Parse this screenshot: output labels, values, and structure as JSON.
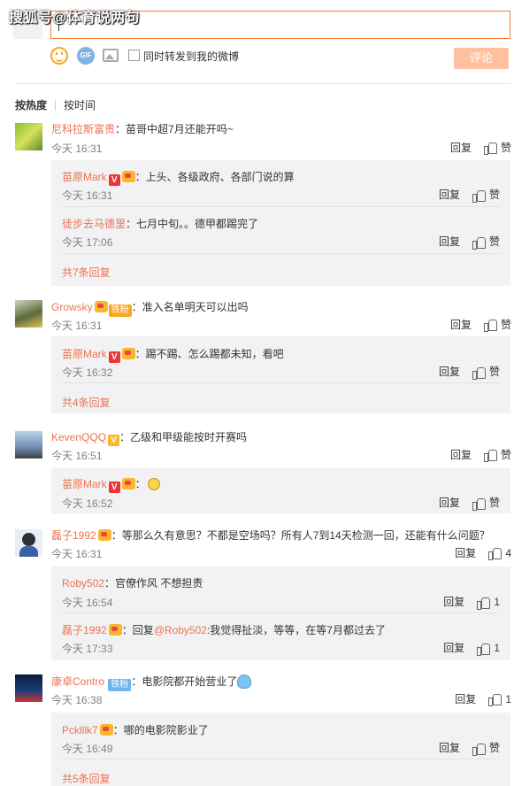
{
  "watermark": "搜狐号@体育说两句",
  "composer": {
    "tool_emoji": "emoji-icon",
    "tool_gif": "GIF",
    "tool_image": "image-icon",
    "repost_label": "同时转发到我的微博",
    "submit_label": "评论"
  },
  "sort": {
    "hot": "按热度",
    "time": "按时间"
  },
  "action_reply": "回复",
  "action_like": "赞",
  "comments": [
    {
      "user": "尼科拉斯富贵",
      "text": "：苗哥中超7月还能开吗~",
      "time": "今天 16:31",
      "replies": [
        {
          "user": "苗原Mark",
          "text": "：上头、各级政府、各部门说的算",
          "time": "今天 16:31"
        },
        {
          "user": "徒步去马德里",
          "text": "：七月中旬。。德甲都踢完了",
          "time": "今天 17:06"
        }
      ],
      "more": "共7条回复"
    },
    {
      "user": "Growsky",
      "badge": "铁粉",
      "text": "：准入名单明天可以出吗",
      "time": "今天 16:31",
      "replies": [
        {
          "user": "苗原Mark",
          "text": "：踢不踢、怎么踢都未知，看吧",
          "time": "今天 16:32"
        }
      ],
      "more": "共4条回复"
    },
    {
      "user": "KevenQQQ",
      "text": "：乙级和甲级能按时开赛吗",
      "time": "今天 16:51",
      "replies": [
        {
          "user": "苗原Mark",
          "text": "：",
          "time": "今天 16:52"
        }
      ]
    },
    {
      "user": "磊子1992",
      "text": "：等那么久有意思？不都是空场吗？所有人7到14天检测一回，还能有什么问题？",
      "time": "今天 16:31",
      "likes": "4",
      "replies": [
        {
          "user": "Roby502",
          "text": "：官僚作风 不想担责",
          "time": "今天 16:54",
          "likes": "1"
        },
        {
          "user": "磊子1992",
          "text_pre": "：回复",
          "mention": "@Roby502",
          "text": ":我觉得扯淡，等等，在等7月都过去了",
          "time": "今天 17:33",
          "likes": "1"
        }
      ]
    },
    {
      "user": "康卓Contro",
      "badge": "铁粉",
      "text": "：电影院都开始营业了",
      "time": "今天 16:38",
      "likes": "1",
      "replies": [
        {
          "user": "Pcklllk7",
          "text": "：哪的电影院影业了",
          "time": "今天 16:49"
        }
      ],
      "more": "共5条回复"
    }
  ]
}
